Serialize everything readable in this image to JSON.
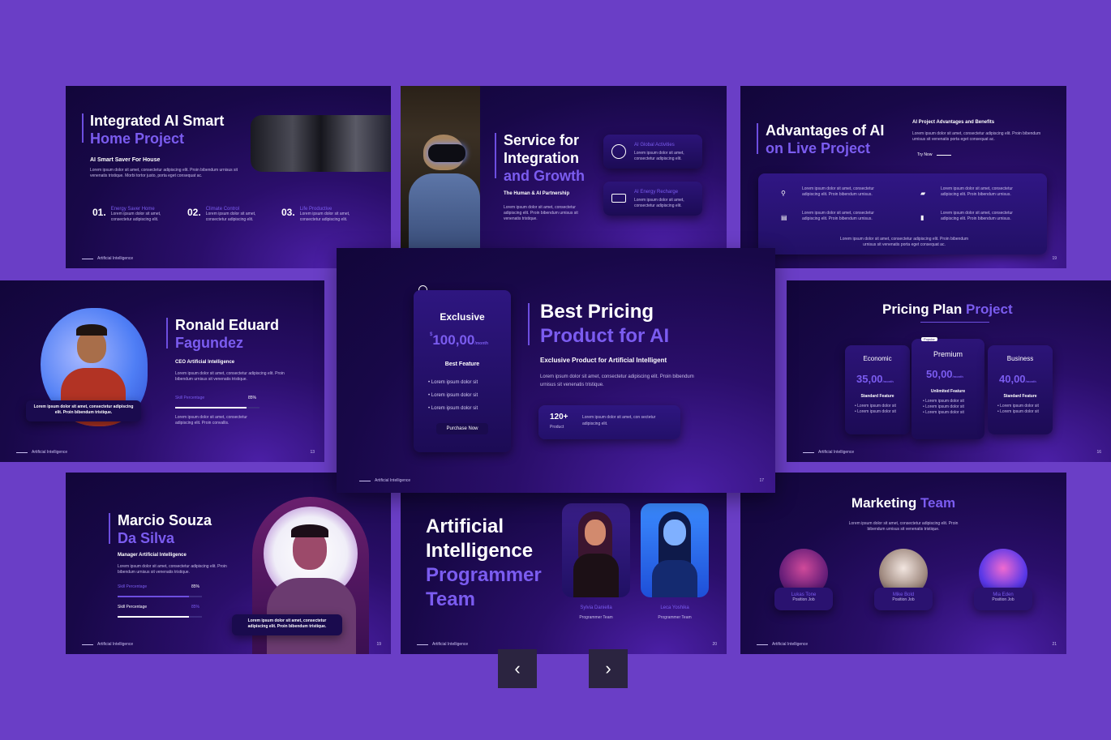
{
  "footer_label": "Artificial Intelligence",
  "slide1": {
    "title_line1": "Integrated AI Smart",
    "title_line2": "Home Project",
    "subtitle": "AI Smart Saver For House",
    "desc": "Lorem ipsum dolor sit amet, consectetur adipiscing elit. Proin bibendum urnisus sit venenatis tristique. Morbi tortor justo, porta eget consequat ac.",
    "items": [
      {
        "num": "01.",
        "label": "Energy Saver Home",
        "desc": "Lorem ipsum dolor sit amet, consectetur adipiscing elit."
      },
      {
        "num": "02.",
        "label": "Climate Control",
        "desc": "Lorem ipsum dolor sit amet, consectetur adipiscing elit."
      },
      {
        "num": "03.",
        "label": "Life Productive",
        "desc": "Lorem ipsum dolor sit amet, consectetur adipiscing elit."
      }
    ]
  },
  "slide2": {
    "title_line1": "Service for",
    "title_line2": "Integration",
    "title_line3": "and Growth",
    "subtitle": "The Human & AI Partnership",
    "desc": "Lorem ipsum dolor sit amet, consectetur adipiscing elit. Proin bibendum urnisus sit venenatis tristique.",
    "cards": [
      {
        "label": "AI Global Activities",
        "desc": "Lorem ipsum dolor sit amet, consectetur adipiscing elit."
      },
      {
        "label": "AI Energy Recharge",
        "desc": "Lorem ipsum dolor sit amet, consectetur adipiscing elit."
      }
    ]
  },
  "slide3": {
    "title_line1": "Advantages of AI",
    "title_line2": "on Live Project",
    "side_title": "AI Project Advantages and Benefits",
    "side_desc": "Lorem ipsum dolor sit amet, consectetur adipiscing elit. Proin bibendum urnisus sit venenatis porta eget consequat ac.",
    "try_label": "Try Now",
    "features": [
      "Lorem ipsum dolor sit amet, consectetur adipiscing elit. Proin bibendum urnisus.",
      "Lorem ipsum dolor sit amet, consectetur adipiscing elit. Proin bibendum urnisus.",
      "Lorem ipsum dolor sit amet, consectetur adipiscing elit. Proin bibendum urnisus.",
      "Lorem ipsum dolor sit amet, consectetur adipiscing elit. Proin bibendum urnisus."
    ],
    "bottom_desc": "Lorem ipsum dolor sit amet, consectetur adipiscing elit. Proin bibendum urnisus sit venenatis porta eget consequat ac.",
    "page": "19"
  },
  "slide4": {
    "name_line1": "Ronald Eduard",
    "name_line2": "Fagundez",
    "role": "CEO Artificial Intelligence",
    "desc": "Lorem ipsum dolor sit amet, consectetur adipiscing elit. Proin bibendum urnisus sit venenatis tristique.",
    "skill_label": "Skill Percentage",
    "skill_value": "85%",
    "skill_fraction": 0.85,
    "desc2": "Lorem ipsum dolor sit amet, consectetur adipiscing elit. Proin convallis.",
    "quote": "Lorem ipsum dolor sit amet, consectetur adipiscing elit. Proin bibendum tristique.",
    "page": "13"
  },
  "slide5": {
    "plan_name": "Exclusive",
    "price": "100,00",
    "price_unit": "/month",
    "currency": "$",
    "feature_title": "Best Feature",
    "features": [
      "Lorem ipsum dolor sit",
      "Lorem ipsum dolor sit",
      "Lorem ipsum dolor sit"
    ],
    "button": "Purchase Now",
    "title_line1": "Best Pricing",
    "title_line2": "Product for AI",
    "subtitle": "Exclusive Product for Artificial Intelligent",
    "desc": "Lorem ipsum dolor sit amet, consectetur adipiscing elit. Proin bibendum urnisus sit venenatis tristique.",
    "stat_value": "120+",
    "stat_label": "Product",
    "stat_desc": "Lorem ipsum dolor sit amet, con sectetur adipiscing elit.",
    "page": "17"
  },
  "slide6": {
    "title_main": "Pricing Plan",
    "title_accent": "Project",
    "plans": [
      {
        "name": "Economic",
        "price": "35,00",
        "unit": "/month",
        "feature": "Standard Feature",
        "items": [
          "Lorem ipsum dolor sit",
          "Lorem ipsum dolor sit"
        ]
      },
      {
        "name": "Premium",
        "price": "50,00",
        "unit": "/month",
        "feature": "Unlimited Feature",
        "items": [
          "Lorem ipsum dolor sit",
          "Lorem ipsum dolor sit",
          "Lorem ipsum dolor sit"
        ],
        "tag": "Popular"
      },
      {
        "name": "Business",
        "price": "40,00",
        "unit": "/month",
        "feature": "Standard Feature",
        "items": [
          "Lorem ipsum dolor sit",
          "Lorem ipsum dolor sit"
        ]
      }
    ],
    "page": "16"
  },
  "slide7": {
    "name_line1": "Marcio Souza",
    "name_line2": "Da Silva",
    "role": "Manager Artificial Intelligence",
    "desc": "Lorem ipsum dolor sit amet, consectetur adipiscing elit. Proin bibendum urnisus sit venenatis tristique.",
    "skills": [
      {
        "label": "Skill Percentage",
        "value": "85%",
        "fraction": 0.85
      },
      {
        "label": "Skill Percentage",
        "value": "85%",
        "fraction": 0.85
      }
    ],
    "quote": "Lorem ipsum dolor sit amet, consectetur adipiscing elit. Proin bibendum tristique.",
    "page": "19"
  },
  "slide8": {
    "title_line1": "Artificial",
    "title_line2": "Intelligence",
    "title_line3": "Programmer",
    "title_line4": "Team",
    "members": [
      {
        "name": "Sylvia Daniella",
        "role": "Programmer Team"
      },
      {
        "name": "Leca Yoshika",
        "role": "Programmer Team"
      }
    ],
    "page": "20"
  },
  "slide9": {
    "title_main": "Marketing",
    "title_accent": "Team",
    "desc": "Lorem ipsum dolor sit amet, consectetur adipiscing elit. Proin bibendum urnisus sit venenatis tristique.",
    "members": [
      {
        "name": "Lukas Tone",
        "role": "Position Job"
      },
      {
        "name": "Mike Bold",
        "role": "Position Job"
      },
      {
        "name": "Mia Eden",
        "role": "Position Job"
      }
    ],
    "page": "21"
  },
  "nav": {
    "prev": "‹",
    "next": "›"
  },
  "colors": {
    "background": "#6a3ec6",
    "accent": "#7b5cf0",
    "nav_button": "#2b2440"
  }
}
